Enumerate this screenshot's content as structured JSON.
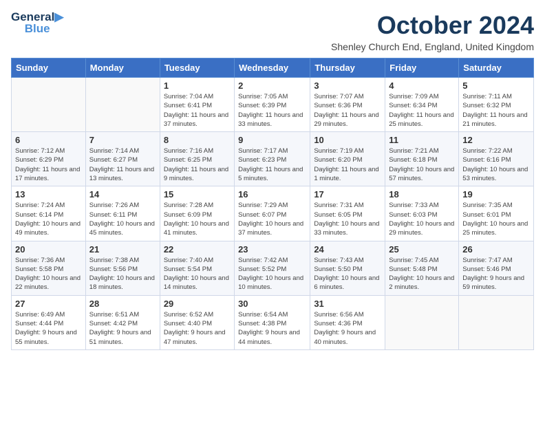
{
  "logo": {
    "line1": "General",
    "line2": "Blue"
  },
  "header": {
    "title": "October 2024",
    "subtitle": "Shenley Church End, England, United Kingdom"
  },
  "weekdays": [
    "Sunday",
    "Monday",
    "Tuesday",
    "Wednesday",
    "Thursday",
    "Friday",
    "Saturday"
  ],
  "weeks": [
    [
      null,
      null,
      {
        "day": 1,
        "sunrise": "7:04 AM",
        "sunset": "6:41 PM",
        "daylight": "11 hours and 37 minutes."
      },
      {
        "day": 2,
        "sunrise": "7:05 AM",
        "sunset": "6:39 PM",
        "daylight": "11 hours and 33 minutes."
      },
      {
        "day": 3,
        "sunrise": "7:07 AM",
        "sunset": "6:36 PM",
        "daylight": "11 hours and 29 minutes."
      },
      {
        "day": 4,
        "sunrise": "7:09 AM",
        "sunset": "6:34 PM",
        "daylight": "11 hours and 25 minutes."
      },
      {
        "day": 5,
        "sunrise": "7:11 AM",
        "sunset": "6:32 PM",
        "daylight": "11 hours and 21 minutes."
      }
    ],
    [
      {
        "day": 6,
        "sunrise": "7:12 AM",
        "sunset": "6:29 PM",
        "daylight": "11 hours and 17 minutes."
      },
      {
        "day": 7,
        "sunrise": "7:14 AM",
        "sunset": "6:27 PM",
        "daylight": "11 hours and 13 minutes."
      },
      {
        "day": 8,
        "sunrise": "7:16 AM",
        "sunset": "6:25 PM",
        "daylight": "11 hours and 9 minutes."
      },
      {
        "day": 9,
        "sunrise": "7:17 AM",
        "sunset": "6:23 PM",
        "daylight": "11 hours and 5 minutes."
      },
      {
        "day": 10,
        "sunrise": "7:19 AM",
        "sunset": "6:20 PM",
        "daylight": "11 hours and 1 minute."
      },
      {
        "day": 11,
        "sunrise": "7:21 AM",
        "sunset": "6:18 PM",
        "daylight": "10 hours and 57 minutes."
      },
      {
        "day": 12,
        "sunrise": "7:22 AM",
        "sunset": "6:16 PM",
        "daylight": "10 hours and 53 minutes."
      }
    ],
    [
      {
        "day": 13,
        "sunrise": "7:24 AM",
        "sunset": "6:14 PM",
        "daylight": "10 hours and 49 minutes."
      },
      {
        "day": 14,
        "sunrise": "7:26 AM",
        "sunset": "6:11 PM",
        "daylight": "10 hours and 45 minutes."
      },
      {
        "day": 15,
        "sunrise": "7:28 AM",
        "sunset": "6:09 PM",
        "daylight": "10 hours and 41 minutes."
      },
      {
        "day": 16,
        "sunrise": "7:29 AM",
        "sunset": "6:07 PM",
        "daylight": "10 hours and 37 minutes."
      },
      {
        "day": 17,
        "sunrise": "7:31 AM",
        "sunset": "6:05 PM",
        "daylight": "10 hours and 33 minutes."
      },
      {
        "day": 18,
        "sunrise": "7:33 AM",
        "sunset": "6:03 PM",
        "daylight": "10 hours and 29 minutes."
      },
      {
        "day": 19,
        "sunrise": "7:35 AM",
        "sunset": "6:01 PM",
        "daylight": "10 hours and 25 minutes."
      }
    ],
    [
      {
        "day": 20,
        "sunrise": "7:36 AM",
        "sunset": "5:58 PM",
        "daylight": "10 hours and 22 minutes."
      },
      {
        "day": 21,
        "sunrise": "7:38 AM",
        "sunset": "5:56 PM",
        "daylight": "10 hours and 18 minutes."
      },
      {
        "day": 22,
        "sunrise": "7:40 AM",
        "sunset": "5:54 PM",
        "daylight": "10 hours and 14 minutes."
      },
      {
        "day": 23,
        "sunrise": "7:42 AM",
        "sunset": "5:52 PM",
        "daylight": "10 hours and 10 minutes."
      },
      {
        "day": 24,
        "sunrise": "7:43 AM",
        "sunset": "5:50 PM",
        "daylight": "10 hours and 6 minutes."
      },
      {
        "day": 25,
        "sunrise": "7:45 AM",
        "sunset": "5:48 PM",
        "daylight": "10 hours and 2 minutes."
      },
      {
        "day": 26,
        "sunrise": "7:47 AM",
        "sunset": "5:46 PM",
        "daylight": "9 hours and 59 minutes."
      }
    ],
    [
      {
        "day": 27,
        "sunrise": "6:49 AM",
        "sunset": "4:44 PM",
        "daylight": "9 hours and 55 minutes."
      },
      {
        "day": 28,
        "sunrise": "6:51 AM",
        "sunset": "4:42 PM",
        "daylight": "9 hours and 51 minutes."
      },
      {
        "day": 29,
        "sunrise": "6:52 AM",
        "sunset": "4:40 PM",
        "daylight": "9 hours and 47 minutes."
      },
      {
        "day": 30,
        "sunrise": "6:54 AM",
        "sunset": "4:38 PM",
        "daylight": "9 hours and 44 minutes."
      },
      {
        "day": 31,
        "sunrise": "6:56 AM",
        "sunset": "4:36 PM",
        "daylight": "9 hours and 40 minutes."
      },
      null,
      null
    ]
  ]
}
